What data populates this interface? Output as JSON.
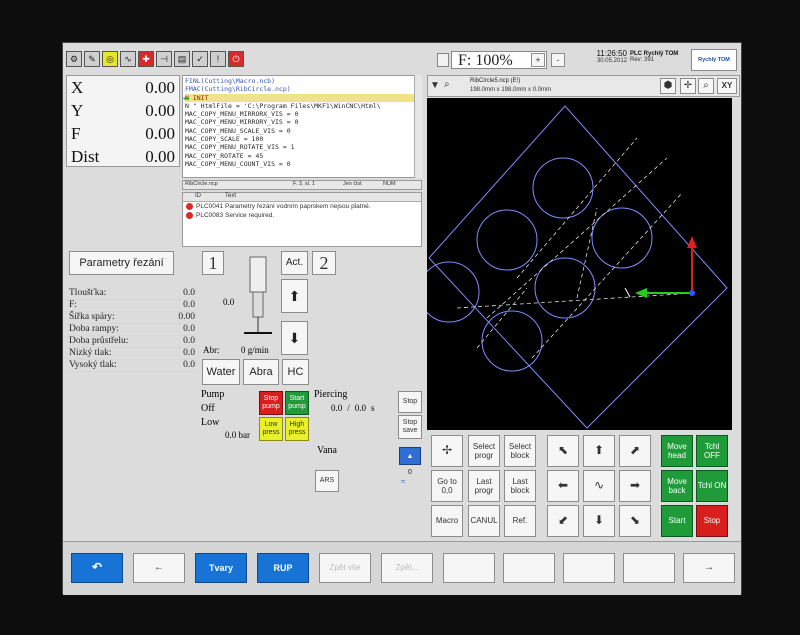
{
  "toolbar": {
    "icons": [
      "gear-icon",
      "wrench-icon",
      "spiral-icon",
      "wave-icon",
      "target-icon",
      "tool-icon",
      "ruler-icon",
      "bulb-icon",
      "pen-icon",
      "power-icon"
    ]
  },
  "feed": {
    "label": "F: 100%",
    "plus": "+",
    "minus": "-"
  },
  "clock": {
    "time": "11:26:50",
    "date": "30.05.2012"
  },
  "plc": {
    "title": "PLC Rychlý TOM",
    "rev": "Rev: 391"
  },
  "logo": {
    "text": "Rychlý TOM"
  },
  "coords": [
    {
      "label": "X",
      "value": "0.00"
    },
    {
      "label": "Y",
      "value": "0.00"
    },
    {
      "label": "F",
      "value": "0.00"
    },
    {
      "label": "Dist",
      "value": "0.00"
    }
  ],
  "code": {
    "lines": [
      "FINL(Cutting\\Macro.ncb)",
      "FMAC(Cutting\\RibCircle.ncp)",
      "N  INIT",
      "N   \" HtmlFile = 'C:\\Program Files\\MKF1\\WinCNC\\Html\\",
      "    MAC_COPY_MENU_MIRRORX_VIS = 0",
      "    MAC_COPY_MENU_MIRRORY_VIS = 0",
      "    MAC_COPY_MENU_SCALE_VIS = 0",
      "    MAC_COPY_SCALE = 100",
      "    MAC_COPY_MENU_ROTATE_VIS = 1",
      "    MAC_COPY_ROTATE = 45",
      "    MAC_COPY_MENU_COUNT_VIS = 0"
    ]
  },
  "status": {
    "file": "RibCircle.ncp",
    "pos": "F. 3, sl. 1",
    "mode": "Jen čist",
    "num": "NUM"
  },
  "messages": {
    "headers": [
      "ID",
      "Text"
    ],
    "rows": [
      {
        "id": "PLC0041",
        "text": "Parametry řezání vodním paprskem nejsou platné."
      },
      {
        "id": "PLC0083",
        "text": "Service required."
      }
    ]
  },
  "params": {
    "title": "Parametry řezání",
    "rows": [
      {
        "label": "Tloušťka:",
        "value": "0.0"
      },
      {
        "label": "F:",
        "value": "0.0"
      },
      {
        "label": "Šířka spáry:",
        "value": "0.00"
      },
      {
        "label": "Doba rampy:",
        "value": "0.0"
      },
      {
        "label": "Doba průstřelu:",
        "value": "0.0"
      },
      {
        "label": "Nízký tlak:",
        "value": "0.0"
      },
      {
        "label": "Vysoký tlak:",
        "value": "0.0"
      }
    ]
  },
  "head1": {
    "num": "1",
    "z": "0.0",
    "abr_label": "Abr:",
    "abr_value": "0 g/min",
    "act": "Act."
  },
  "head2": {
    "num": "2"
  },
  "abr_buttons": [
    "Water",
    "Abra",
    "HC"
  ],
  "pump": {
    "title": "Pump",
    "state": "Off",
    "level": "Low",
    "pressure": "0.0 bar",
    "stop": "Stop pump",
    "start": "Start pump",
    "low": "Low press",
    "high": "High press"
  },
  "piercing": {
    "title": "Piercing",
    "v1": "0.0",
    "sep": "/",
    "v2": "0.0",
    "unit": "s",
    "stop": "Stop",
    "stop_save": "Stop save"
  },
  "vana": {
    "title": "Vana",
    "ars": "ARS",
    "level": "0"
  },
  "view": {
    "file": "RibCircle5.ncp (E!)",
    "size": "198.0mm x 198.0mm x 0.0mm",
    "xy": "XY"
  },
  "control": {
    "mid": [
      [
        "Select progr",
        "Select block"
      ],
      [
        "Last progr",
        "Last block"
      ],
      [
        "CANUL",
        "Ref."
      ]
    ],
    "left": [
      "",
      "Go to 0,0",
      "Macro"
    ],
    "right": [
      [
        "Move head",
        "Tchl OFF"
      ],
      [
        "Move back",
        "Tchl ON"
      ],
      [
        "Start",
        "Stop"
      ]
    ]
  },
  "bottom": {
    "b1": "",
    "b2": "←",
    "b3": "Tvary",
    "b4": "RUP",
    "b5": "Zpět vše",
    "b6": "Zpět...",
    "b7": "",
    "b8": "",
    "b9": "",
    "b10": "",
    "b11": "→"
  }
}
